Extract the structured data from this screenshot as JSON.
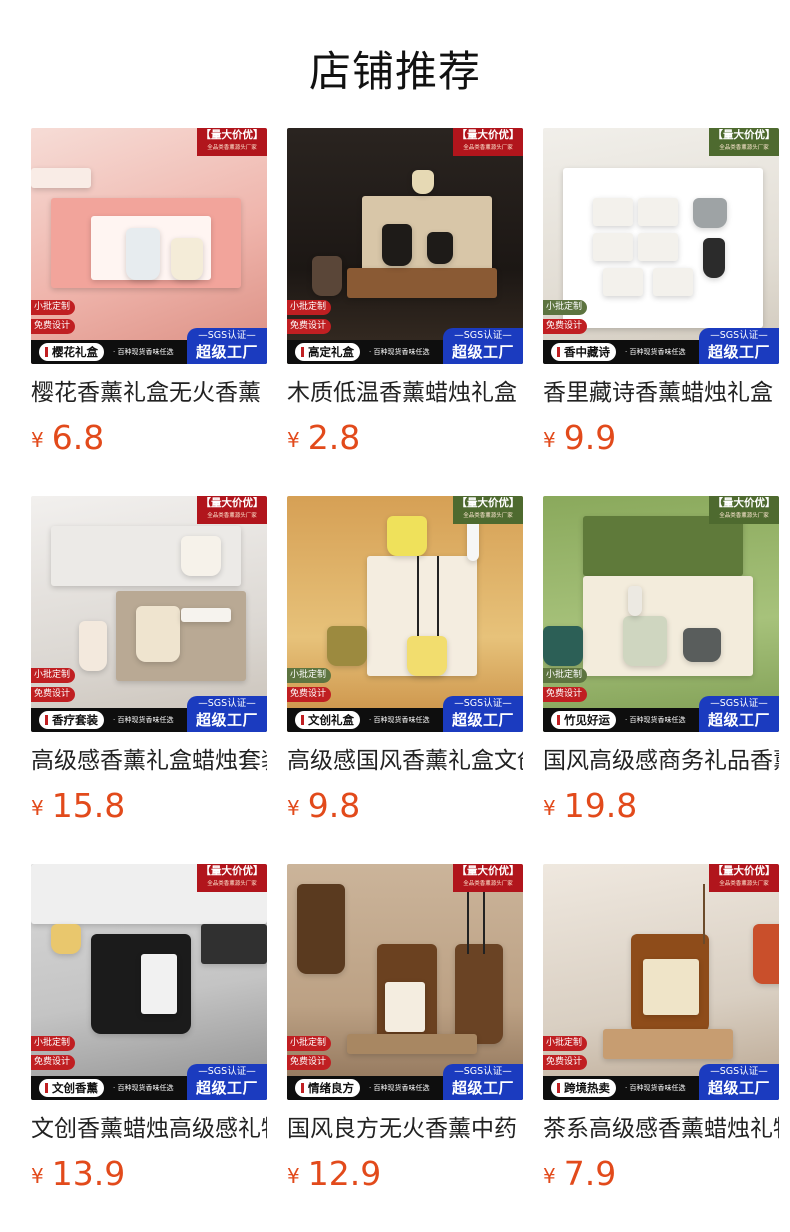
{
  "page_title": "店铺推荐",
  "badge": {
    "top_main": "【量大价优】",
    "top_sub": "全品类香薰源头厂家",
    "tag1": "小批定制",
    "tag2": "免费设计",
    "banner_sub": "· 百种现货香味任选",
    "sgs": "—SGS认证—",
    "factory": "超级工厂"
  },
  "currency": "¥",
  "products": [
    {
      "banner_label": "樱花礼盒",
      "name": "樱花香薰礼盒无火香薰",
      "price": "6.8",
      "theme": "pink",
      "badge_color": "#b1151c"
    },
    {
      "banner_label": "高定礼盒",
      "name": "木质低温香薰蜡烛礼盒",
      "price": "2.8",
      "theme": "dark",
      "badge_color": "#b1151c"
    },
    {
      "banner_label": "香中藏诗",
      "name": "香里藏诗香薰蜡烛礼盒",
      "price": "9.9",
      "theme": "white",
      "badge_color": "#4e6a2f"
    },
    {
      "banner_label": "香疗套装",
      "name": "高级感香薰礼盒蜡烛套装",
      "price": "15.8",
      "theme": "marble",
      "badge_color": "#b1151c"
    },
    {
      "banner_label": "文创礼盒",
      "name": "高级感国风香薰礼盒文创",
      "price": "9.8",
      "theme": "amber",
      "badge_color": "#4e6a2f"
    },
    {
      "banner_label": "竹见好运",
      "name": "国风高级感商务礼品香薰",
      "price": "19.8",
      "theme": "green",
      "badge_color": "#4e6a2f"
    },
    {
      "banner_label": "文创香薰",
      "name": "文创香薰蜡烛高级感礼物",
      "price": "13.9",
      "theme": "grey",
      "badge_color": "#b1151c"
    },
    {
      "banner_label": "情绪良方",
      "name": "国风良方无火香薰中药",
      "price": "12.9",
      "theme": "tan",
      "badge_color": "#b1151c"
    },
    {
      "banner_label": "跨境热卖",
      "name": "茶系高级感香薰蜡烛礼物",
      "price": "7.9",
      "theme": "warm",
      "badge_color": "#b1151c"
    }
  ]
}
